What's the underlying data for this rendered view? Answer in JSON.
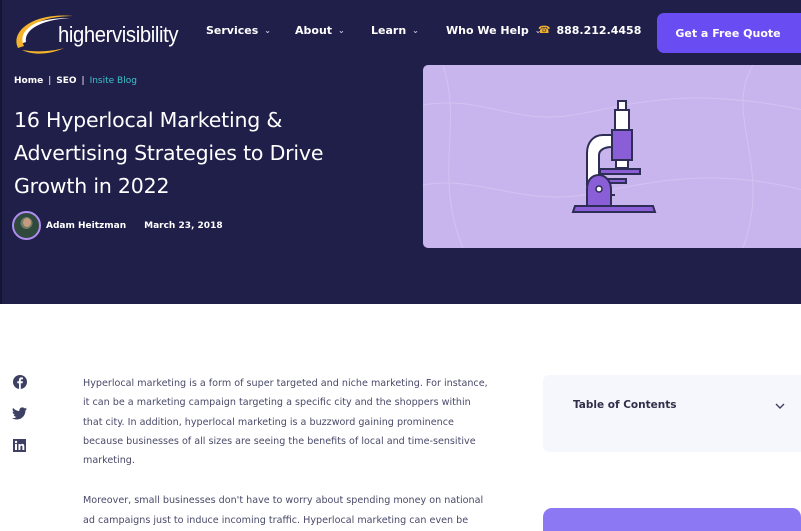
{
  "header": {
    "logo_text": "highervisibility",
    "nav": [
      {
        "label": "Services",
        "has_dropdown": true
      },
      {
        "label": "About",
        "has_dropdown": true
      },
      {
        "label": "Learn",
        "has_dropdown": true
      },
      {
        "label": "Who We Help",
        "has_dropdown": true
      }
    ],
    "phone": "888.212.4458",
    "cta_label": "Get a Free Quote",
    "colors": {
      "background": "#1f1f4a",
      "accent": "#6a4cf3",
      "logo_swoosh": "#f5b32a"
    }
  },
  "breadcrumb": [
    {
      "label": "Home"
    },
    {
      "label": "SEO"
    },
    {
      "label": "Insite Blog",
      "current": true
    }
  ],
  "breadcrumb_separator": "|",
  "article": {
    "title": "16 Hyperlocal Marketing & Advertising Strategies to Drive Growth in 2022",
    "author": "Adam Heitzman",
    "date": "March 23, 2018",
    "feature_image": "microscope-illustration",
    "paragraphs": [
      "Hyperlocal marketing is a form of super targeted and niche marketing. For instance, it can be a marketing campaign targeting a specific city and the shoppers within that city. In addition, hyperlocal marketing is a buzzword gaining prominence because businesses of all sizes are seeing the benefits of local and time-sensitive marketing.",
      "Moreover, small businesses don't have to worry about spending money on national ad campaigns just to induce incoming traffic. Hyperlocal marketing can even be"
    ]
  },
  "share": [
    {
      "icon": "facebook-icon"
    },
    {
      "icon": "twitter-icon"
    },
    {
      "icon": "linkedin-icon"
    }
  ],
  "sidebar": {
    "toc_label": "Table of Contents"
  }
}
